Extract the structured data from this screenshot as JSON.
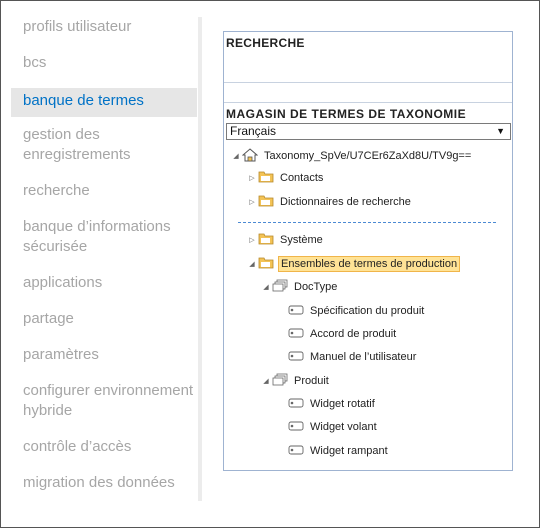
{
  "nav": {
    "items": [
      {
        "label": "profils utilisateur"
      },
      {
        "label": "bcs"
      },
      {
        "label": "banque de termes",
        "selected": true
      },
      {
        "label": "gestion des enregistrements"
      },
      {
        "label": "recherche"
      },
      {
        "label": "banque d’informations sécurisée"
      },
      {
        "label": "applications"
      },
      {
        "label": "partage"
      },
      {
        "label": "paramètres"
      },
      {
        "label": "configurer environnement hybride"
      },
      {
        "label": "contrôle d’accès"
      },
      {
        "label": "migration des données"
      }
    ]
  },
  "panel": {
    "search_title": "RECHERCHE",
    "store_title": "MAGASIN DE TERMES DE TAXONOMIE",
    "language": "Français",
    "tree": {
      "root": "Taxonomy_SpVe/U7CEr6ZaXd8U/TV9g==",
      "group_contacts": "Contacts",
      "group_dictionaries": "Dictionnaires de recherche",
      "group_system": "Système",
      "group_production": "Ensembles de termes de production",
      "termset_doctype": "DocType",
      "doctype_terms": [
        "Spécification du produit",
        "Accord de produit",
        "Manuel de l’utilisateur"
      ],
      "termset_product": "Produit",
      "product_terms": [
        "Widget rotatif",
        "Widget volant",
        "Widget rampant"
      ]
    }
  },
  "colors": {
    "nav_selected_text": "#0072c6",
    "nav_selected_bg": "#e6e6e6",
    "nav_text": "#a6a6a6",
    "highlight_bg": "#ffe396",
    "highlight_border": "#f0b54a",
    "folder": "#f3c356"
  }
}
